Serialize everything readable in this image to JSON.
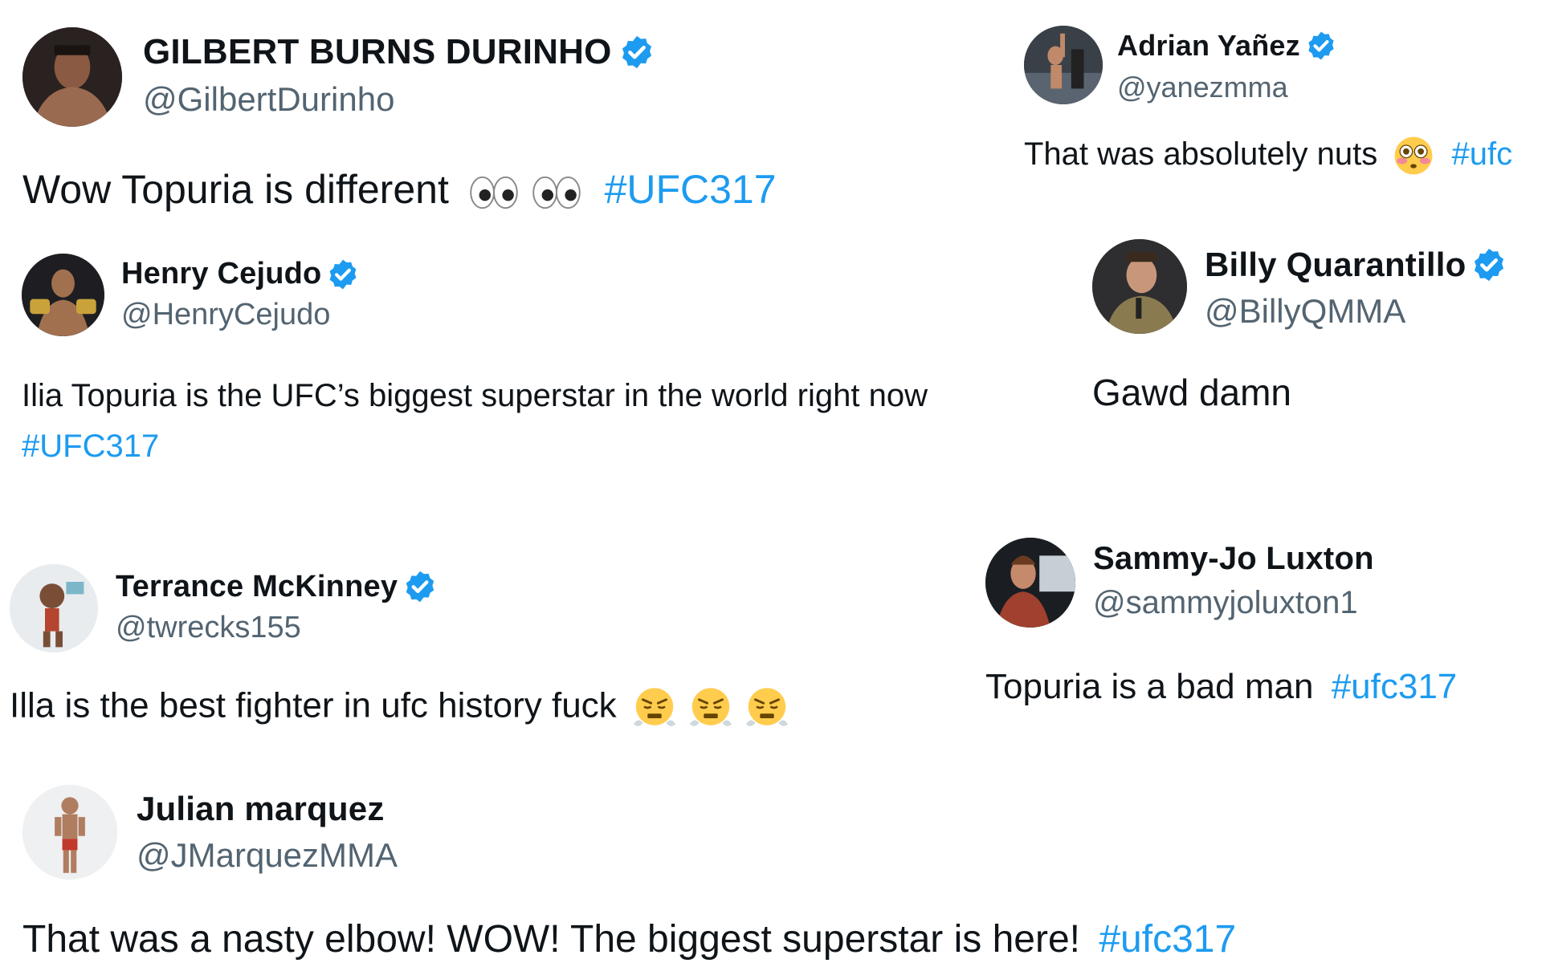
{
  "colors": {
    "link": "#1d9bf0",
    "handle": "#536471",
    "text": "#0f1419",
    "verified": "#1d9bf0"
  },
  "tweets": [
    {
      "name": "GILBERT BURNS DURINHO",
      "handle": "@GilbertDurinho",
      "verified": true,
      "text": "Wow Topuria is different",
      "emoji": [
        "eyes",
        "eyes"
      ],
      "hashtag": "#UFC317"
    },
    {
      "name": "Adrian Yañez",
      "handle": "@yanezmma",
      "verified": true,
      "text": "That was absolutely nuts",
      "emoji": [
        "flushed-face"
      ],
      "hashtag": "#ufc"
    },
    {
      "name": "Henry Cejudo",
      "handle": "@HenryCejudo",
      "verified": true,
      "text": "Ilia Topuria is the UFC’s biggest superstar in the world right now",
      "hashtag": "#UFC317"
    },
    {
      "name": "Billy Quarantillo",
      "handle": "@BillyQMMA",
      "verified": true,
      "text": "Gawd damn"
    },
    {
      "name": "Terrance McKinney",
      "handle": "@twrecks155",
      "verified": true,
      "text": "Illa is the best fighter in ufc history fuck",
      "emoji": [
        "steam-face",
        "steam-face",
        "steam-face"
      ]
    },
    {
      "name": "Sammy-Jo Luxton",
      "handle": "@sammyjoluxton1",
      "verified": false,
      "text": "Topuria is a bad man",
      "hashtag": "#ufc317"
    },
    {
      "name": "Julian marquez",
      "handle": "@JMarquezMMA",
      "verified": false,
      "text": "That was a nasty elbow! WOW! The biggest superstar is here!",
      "hashtag": "#ufc317"
    }
  ]
}
